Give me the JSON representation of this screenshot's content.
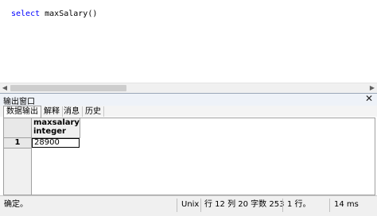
{
  "editor": {
    "sql_keyword": "select",
    "sql_rest": " maxSalary()"
  },
  "output": {
    "title": "输出窗口",
    "close_symbol": "✕",
    "tabs": [
      "数据输出",
      "解释",
      "消息",
      "历史"
    ]
  },
  "grid": {
    "column_name": "maxsalary",
    "column_type": "integer",
    "row_number": "1",
    "value": "28900"
  },
  "status": {
    "message": "确定。",
    "line_ending": "Unix",
    "position": "行 12 列 20 字数 253",
    "rows": "1 行。",
    "time": "14 ms"
  }
}
